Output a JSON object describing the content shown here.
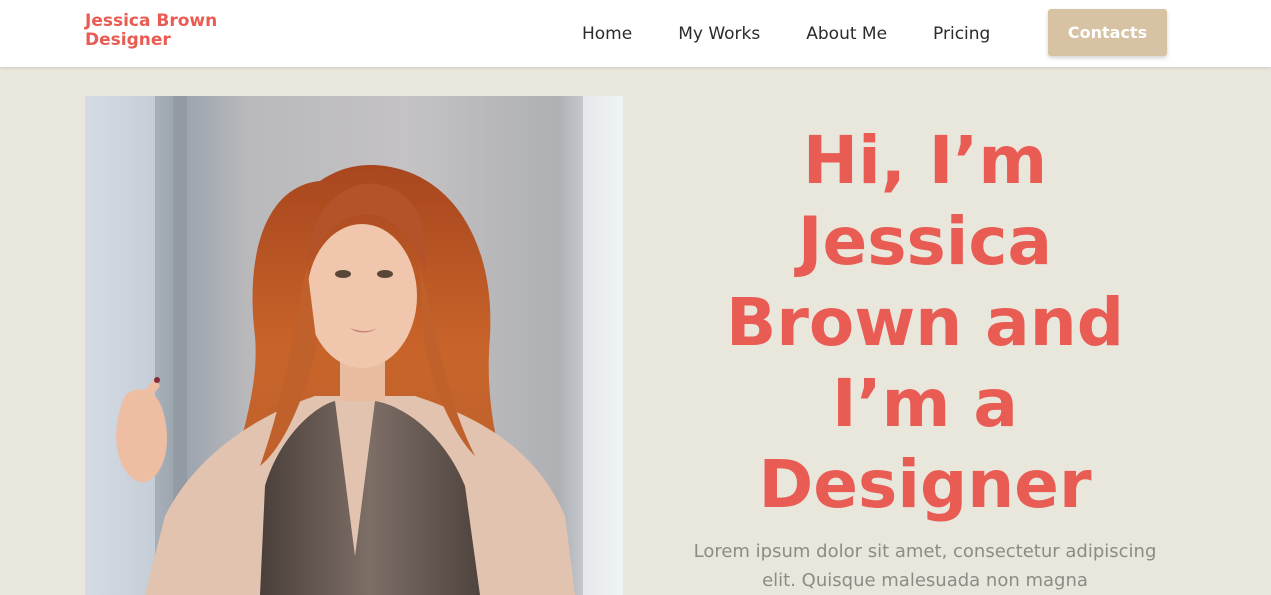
{
  "brand": {
    "line1": "Jessica Brown",
    "line2": "Designer",
    "color": "#e95c54"
  },
  "nav": {
    "items": [
      {
        "label": "Home"
      },
      {
        "label": "My Works"
      },
      {
        "label": "About Me"
      },
      {
        "label": "Pricing"
      }
    ],
    "cta_label": "Contacts",
    "cta_color": "#d7c2a4"
  },
  "hero": {
    "title_lines": [
      "Hi, I’m",
      "Jessica",
      "Brown and",
      "I’m a",
      "Designer"
    ],
    "description": "Lorem ipsum dolor sit amet, consectetur adipiscing elit. Quisque malesuada non magna",
    "title_color": "#e95c54",
    "background": "#e9e6dc",
    "photo_icon": "portrait-photo"
  }
}
